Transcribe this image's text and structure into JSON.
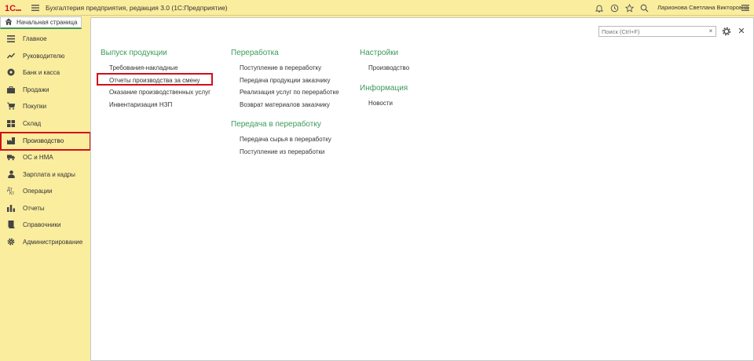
{
  "app": {
    "logo_text": "1С",
    "title": "Бухгалтерия предприятия, редакция 3.0  (1С:Предприятие)",
    "user_name": "Ларионова Светлана Викторовна"
  },
  "home_tab": {
    "label": "Начальная страница"
  },
  "sidebar": {
    "items": [
      {
        "label": "Главное",
        "icon": "list-icon"
      },
      {
        "label": "Руководителю",
        "icon": "trend-icon"
      },
      {
        "label": "Банк и касса",
        "icon": "coin-icon"
      },
      {
        "label": "Продажи",
        "icon": "briefcase-icon"
      },
      {
        "label": "Покупки",
        "icon": "cart-icon"
      },
      {
        "label": "Склад",
        "icon": "grid-icon"
      },
      {
        "label": "Производство",
        "icon": "factory-icon"
      },
      {
        "label": "ОС и НМА",
        "icon": "truck-icon"
      },
      {
        "label": "Зарплата и кадры",
        "icon": "person-icon"
      },
      {
        "label": "Операции",
        "icon": "operations-icon"
      },
      {
        "label": "Отчеты",
        "icon": "bar-chart-icon"
      },
      {
        "label": "Справочники",
        "icon": "book-icon"
      },
      {
        "label": "Администрирование",
        "icon": "gear-icon"
      }
    ]
  },
  "search": {
    "placeholder": "Поиск (Ctrl+F)",
    "clear_glyph": "×"
  },
  "close_glyph": "✕",
  "sections": {
    "output": {
      "title": "Выпуск продукции",
      "links": [
        "Требования-накладные",
        "Отчеты производства за смену",
        "Оказание производственных услуг",
        "Инвентаризация НЗП"
      ]
    },
    "processing": {
      "title": "Переработка",
      "links": [
        "Поступление в переработку",
        "Передача продукции заказчику",
        "Реализация услуг по переработке",
        "Возврат материалов заказчику"
      ]
    },
    "transfer": {
      "title": "Передача в переработку",
      "links": [
        "Передача сырья в переработку",
        "Поступление из переработки"
      ]
    },
    "settings": {
      "title": "Настройки",
      "links": [
        "Производство"
      ]
    },
    "info": {
      "title": "Информация",
      "links": [
        "Новости"
      ]
    }
  },
  "colors": {
    "accent_green": "#3c9a5a",
    "highlight_red": "#d0101a",
    "panel_yellow": "#fbed9e"
  }
}
